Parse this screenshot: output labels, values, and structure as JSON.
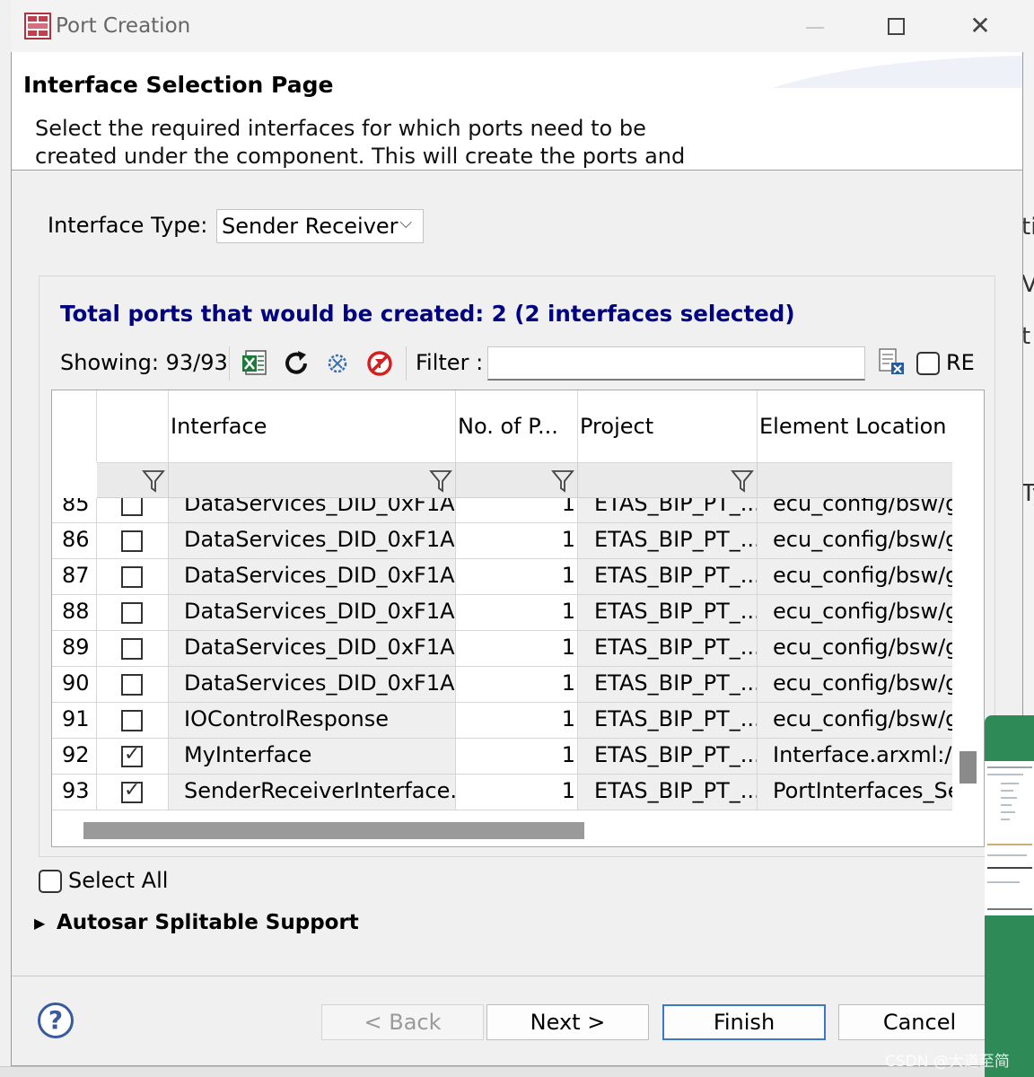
{
  "window": {
    "title": "Port Creation",
    "close_glyph": "✕"
  },
  "header": {
    "title": "Interface Selection Page",
    "description": "Select the required interfaces for which ports need to be created under the component. This will create the ports and assign the"
  },
  "interface_type": {
    "label": "Interface Type:",
    "selected": "Sender Receiver",
    "chevron": "⌵"
  },
  "summary": {
    "total_text": "Total ports that would be created: 2 (2 interfaces selected)"
  },
  "toolbar": {
    "showing": "Showing: 93/93",
    "icons": [
      "excel-export-icon",
      "refresh-icon",
      "filter-settings-icon",
      "clear-filter-icon",
      "clear-filter-text-icon"
    ],
    "filter_label": "Filter :",
    "filter_value": "",
    "re_label": "RE",
    "re_checked": false
  },
  "table": {
    "columns": [
      "",
      "",
      "Interface",
      "No. of P...",
      "Project",
      "Element Location"
    ],
    "rows": [
      {
        "num": "85",
        "checked": false,
        "interface": "DataServices_DID_0xF1A...",
        "count": "1",
        "project": "ETAS_BIP_PT_...",
        "location": "ecu_config/bsw/g"
      },
      {
        "num": "86",
        "checked": false,
        "interface": "DataServices_DID_0xF1A...",
        "count": "1",
        "project": "ETAS_BIP_PT_...",
        "location": "ecu_config/bsw/g"
      },
      {
        "num": "87",
        "checked": false,
        "interface": "DataServices_DID_0xF1A...",
        "count": "1",
        "project": "ETAS_BIP_PT_...",
        "location": "ecu_config/bsw/g"
      },
      {
        "num": "88",
        "checked": false,
        "interface": "DataServices_DID_0xF1A...",
        "count": "1",
        "project": "ETAS_BIP_PT_...",
        "location": "ecu_config/bsw/g"
      },
      {
        "num": "89",
        "checked": false,
        "interface": "DataServices_DID_0xF1A...",
        "count": "1",
        "project": "ETAS_BIP_PT_...",
        "location": "ecu_config/bsw/g"
      },
      {
        "num": "90",
        "checked": false,
        "interface": "DataServices_DID_0xF1A...",
        "count": "1",
        "project": "ETAS_BIP_PT_...",
        "location": "ecu_config/bsw/g"
      },
      {
        "num": "91",
        "checked": false,
        "interface": "IOControlResponse",
        "count": "1",
        "project": "ETAS_BIP_PT_...",
        "location": "ecu_config/bsw/g"
      },
      {
        "num": "92",
        "checked": true,
        "interface": "MyInterface",
        "count": "1",
        "project": "ETAS_BIP_PT_...",
        "location": "Interface.arxml:/Ir"
      },
      {
        "num": "93",
        "checked": true,
        "interface": "SenderReceiverInterface...",
        "count": "1",
        "project": "ETAS_BIP_PT_...",
        "location": "PortInterfaces_Se"
      }
    ]
  },
  "select_all": {
    "label": "Select All",
    "checked": false
  },
  "splitable": {
    "arrow": "▶",
    "label": "Autosar Splitable Support"
  },
  "buttons": {
    "help": "?",
    "back": "< Back",
    "next": "Next >",
    "finish": "Finish",
    "cancel": "Cancel"
  },
  "background_fragments": [
    "ti",
    "V",
    "t",
    "Ty"
  ],
  "watermark": "CSDN @大道至简",
  "colors": {
    "summary_text": "#000080",
    "finish_border": "#3c78c8",
    "help_icon": "#3a5aa0",
    "popup_bg": "#2e8b57"
  }
}
